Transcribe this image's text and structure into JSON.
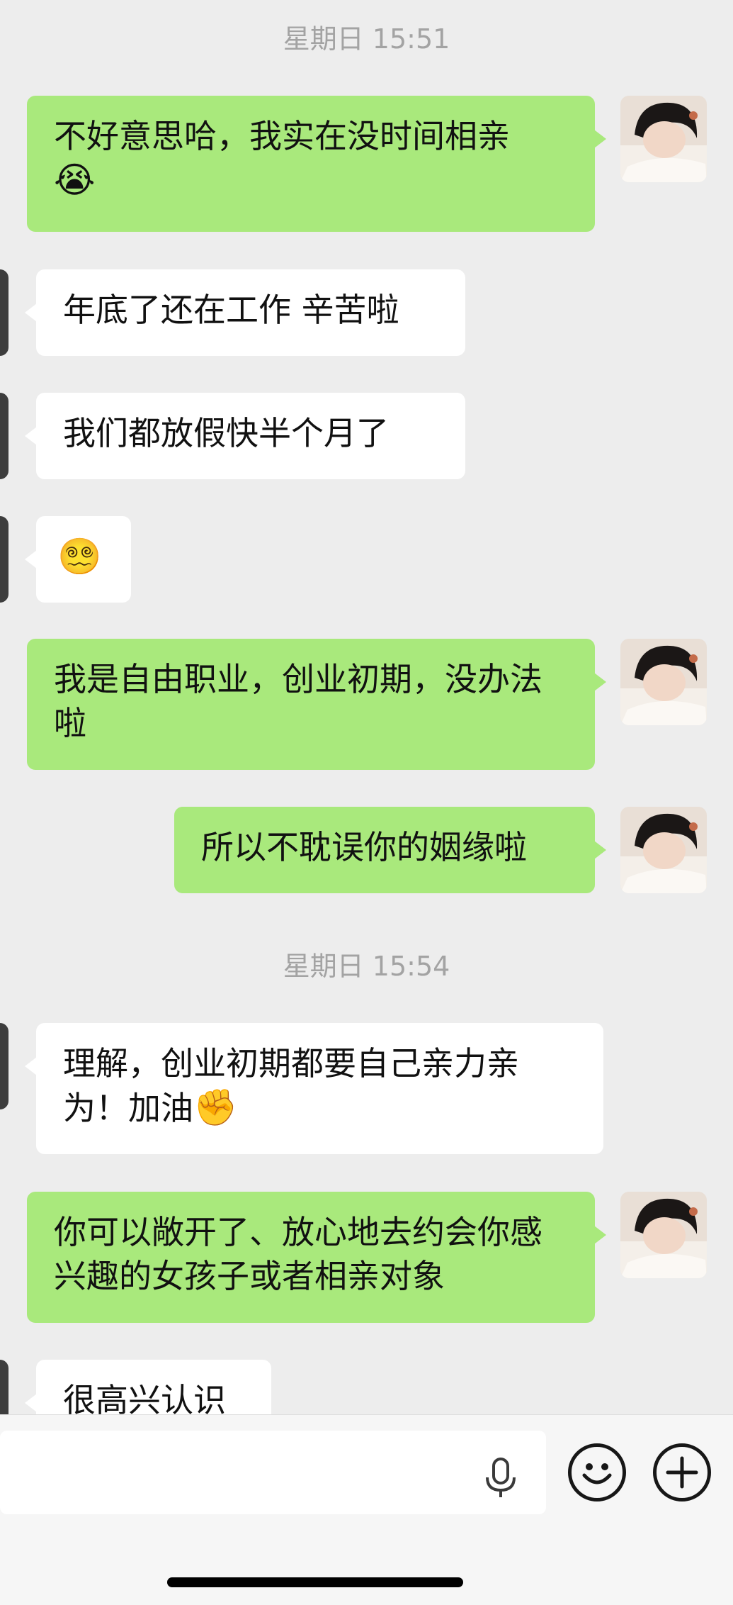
{
  "chat": {
    "timestamps": [
      "星期日 15:51",
      "星期日 15:54"
    ],
    "messages": [
      {
        "from": "me",
        "text": "不好意思哈，我实在没时间相亲",
        "emoji": "😭"
      },
      {
        "from": "peer",
        "text": "年底了还在工作 辛苦啦"
      },
      {
        "from": "peer",
        "text": "我们都放假快半个月了"
      },
      {
        "from": "peer",
        "text": "😵‍💫"
      },
      {
        "from": "me",
        "text": "我是自由职业，创业初期，没办法啦"
      },
      {
        "from": "me",
        "text": "所以不耽误你的姻缘啦"
      },
      {
        "from": "peer",
        "text": "理解，创业初期都要自己亲力亲为！加油",
        "emoji": "✊"
      },
      {
        "from": "me",
        "text": "你可以敞开了、放心地去约会你感兴趣的女孩子或者相亲对象"
      },
      {
        "from": "peer",
        "text": "很高兴认识"
      }
    ]
  },
  "input_bar": {
    "voice_icon": "microphone-icon",
    "emoji_icon": "smiley-icon",
    "more_icon": "plus-icon"
  },
  "colors": {
    "background": "#ededed",
    "my_bubble": "#a9e97c",
    "peer_bubble": "#ffffff",
    "timestamp": "#a3a3a3"
  }
}
